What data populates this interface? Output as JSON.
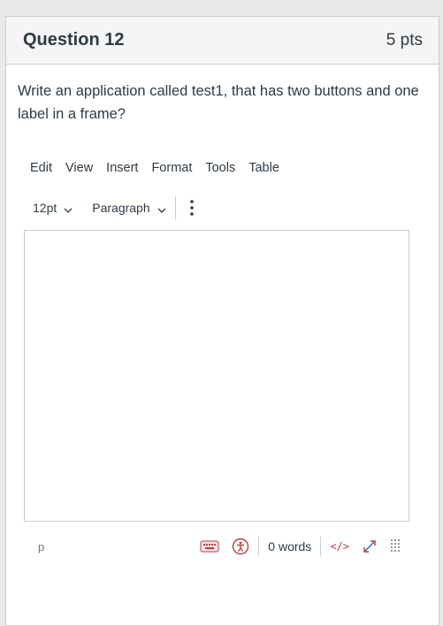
{
  "question": {
    "title": "Question 12",
    "points": "5 pts",
    "text": "Write an application called test1, that has two buttons and one label in a frame?"
  },
  "editor": {
    "menu": [
      "Edit",
      "View",
      "Insert",
      "Format",
      "Tools",
      "Table"
    ],
    "font_size": "12pt",
    "block_format": "Paragraph",
    "content": "",
    "status": {
      "path": "p",
      "word_count": "0 words",
      "html_toggle": "</>"
    }
  },
  "icons": {
    "keyboard": "keyboard-icon",
    "accessibility": "accessibility-icon",
    "html": "code-icon",
    "fullscreen": "expand-icon",
    "resize": "resize-grip-icon",
    "more": "more-vertical-icon"
  },
  "colors": {
    "text": "#2d3b45",
    "border": "#c7cdd1",
    "header_bg": "#f5f5f5",
    "icon_red": "#c23b3b",
    "accent_blue": "#2b6bbf"
  }
}
